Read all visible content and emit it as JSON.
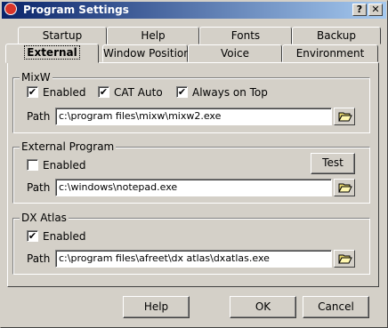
{
  "window": {
    "title": "Program Settings",
    "help_btn": "?",
    "close_btn": "✕"
  },
  "tabs": {
    "back": [
      "Startup",
      "Help",
      "Fonts",
      "Backup"
    ],
    "front": [
      "External",
      "Window Position",
      "Voice",
      "Environment"
    ],
    "active": "External"
  },
  "mixw": {
    "title": "MixW",
    "enabled": {
      "label": "Enabled",
      "checked": true
    },
    "cat_auto": {
      "label": "CAT Auto",
      "checked": true
    },
    "always_on_top": {
      "label": "Always on Top",
      "checked": true
    },
    "path_label": "Path",
    "path_value": "c:\\program files\\mixw\\mixw2.exe"
  },
  "external_program": {
    "title": "External Program",
    "enabled": {
      "label": "Enabled",
      "checked": false
    },
    "test_label": "Test",
    "path_label": "Path",
    "path_value": "c:\\windows\\notepad.exe"
  },
  "dx_atlas": {
    "title": "DX Atlas",
    "enabled": {
      "label": "Enabled",
      "checked": true
    },
    "path_label": "Path",
    "path_value": "c:\\program files\\afreet\\dx atlas\\dxatlas.exe"
  },
  "buttons": {
    "help": "Help",
    "ok": "OK",
    "cancel": "Cancel"
  },
  "check_glyph": "✔",
  "icons": {
    "browse": "folder-open-icon",
    "app": "app-icon"
  }
}
